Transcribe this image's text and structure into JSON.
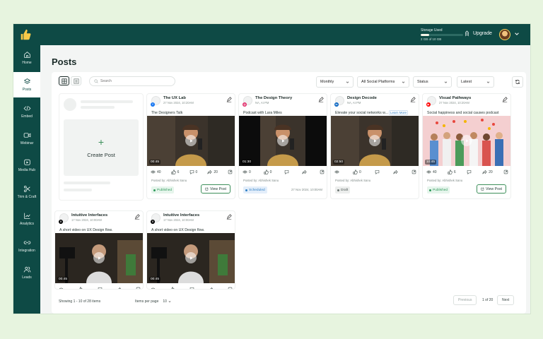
{
  "topbar": {
    "storage_label": "Storage Used",
    "storage_used_text": "2 GB of 10 GB",
    "storage_fraction": 0.2,
    "upgrade_label": "Upgrade"
  },
  "sidebar": {
    "items": [
      {
        "label": "Home",
        "icon": "home-icon"
      },
      {
        "label": "Posts",
        "icon": "posts-icon",
        "active": true
      },
      {
        "label": "Embed",
        "icon": "embed-icon"
      },
      {
        "label": "Webinar",
        "icon": "webinar-icon"
      },
      {
        "label": "Media Hub",
        "icon": "media-hub-icon"
      },
      {
        "label": "Trim & Craft",
        "icon": "scissors-icon"
      },
      {
        "label": "Analytics",
        "icon": "analytics-icon"
      },
      {
        "label": "Integration",
        "icon": "integration-icon"
      },
      {
        "label": "Leads",
        "icon": "leads-icon"
      }
    ]
  },
  "page": {
    "title": "Posts"
  },
  "toolbar": {
    "search_placeholder": "Search",
    "filters": [
      {
        "label": "Monthly"
      },
      {
        "label": "All Social Platforms"
      },
      {
        "label": "Status"
      },
      {
        "label": "Latest"
      }
    ]
  },
  "create_post": {
    "label": "Create Post"
  },
  "cards": [
    {
      "title": "The UX Lab",
      "date": "27 Nov 2024, 10:20AM",
      "description": "The Designers Talk",
      "platform": "facebook",
      "duration": "00:45",
      "views": "40",
      "likes": "6",
      "comments": "0",
      "shares": "20",
      "posted_by": "Posted by: Abhishek Sanu",
      "status": "Published",
      "action": "View Post"
    },
    {
      "title": "The Design Theory",
      "date": "NA, At PM",
      "description": "Podcast with Lara Miles",
      "platform": "instagram",
      "duration": "01:30",
      "views": "0",
      "likes": "0",
      "comments": "",
      "shares": "",
      "posted_by": "Posted by: Abhishek Sanu",
      "status": "Scheduled",
      "stamp": "27 Nov 2024, 10:00AM"
    },
    {
      "title": "Design Decode",
      "date": "NA, At PM",
      "description": "Elevate your social networks w...",
      "learn_more": "Learn More",
      "platform": "linkedin",
      "duration": "02:50",
      "views": "",
      "likes": "0",
      "comments": "",
      "shares": "",
      "posted_by": "Posted by: Abhishek Sanu",
      "status": "Draft"
    },
    {
      "title": "Visual Pathways",
      "date": "27 Nov 2024, 10:20AM",
      "description": "Social happiness and social causes podcast",
      "platform": "youtube",
      "duration": "10:45",
      "views": "40",
      "likes": "6",
      "comments": "",
      "shares": "20",
      "posted_by": "Posted by: Abhishek Sanu",
      "status": "Published",
      "action": "View Post"
    },
    {
      "title": "Intuitive Interfaces",
      "date": "17 Nov 2024, 10:00AM",
      "description": "A short video on UX Design flow.",
      "platform": "x",
      "duration": "00:45",
      "views": "",
      "likes": "",
      "comments": "",
      "shares": ""
    },
    {
      "title": "Intuitive Interfaces",
      "date": "17 Nov 2024, 10:00AM",
      "description": "A short video on UX Design flow.",
      "platform": "x",
      "duration": "00:45",
      "views": "",
      "likes": "",
      "comments": "",
      "shares": ""
    }
  ],
  "pagination": {
    "showing": "Showing 1 - 10 of 28 items",
    "items_per_page_label": "Items per page",
    "items_per_page_value": "10",
    "previous": "Previous",
    "page_info": "1 of 20",
    "next": "Next"
  },
  "colors": {
    "brand": "#0e4a45",
    "accent_green": "#3c8f5a",
    "published": "#2f9a5b",
    "scheduled": "#2f7fc5"
  }
}
